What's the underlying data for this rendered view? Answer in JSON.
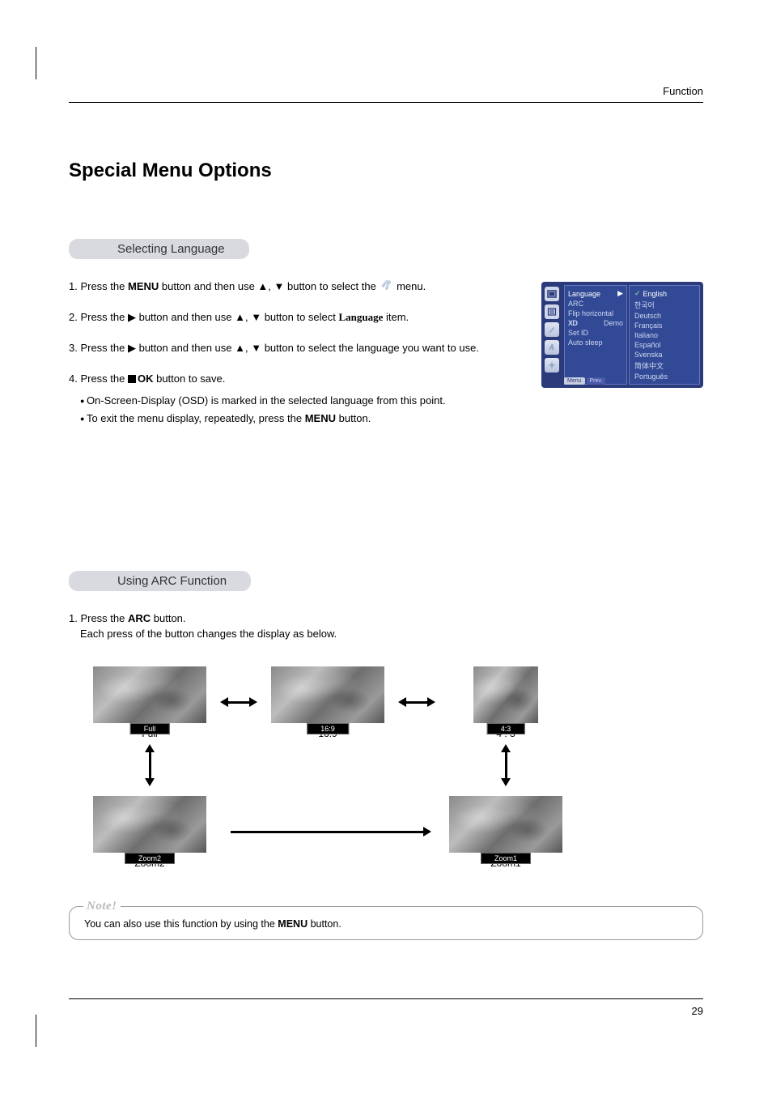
{
  "header": {
    "section": "Function"
  },
  "page_number": "29",
  "title": "Special Menu Options",
  "lang_section": {
    "heading": "Selecting Language",
    "steps": [
      {
        "pre": "1. Press the ",
        "bold": "MENU",
        "post": " button and then use ▲, ▼ button to select the ",
        "tail": " menu."
      },
      {
        "pre": "2. Press the ▶ button and then use ▲, ▼ button to select ",
        "bold": "Language",
        "post": " item."
      },
      {
        "pre": "3. Press the ▶ button and then use ▲, ▼ button to select the language you want to use."
      },
      {
        "pre": "4. Press the ",
        "ok": true,
        "post": " button to save."
      }
    ],
    "bullets": [
      "On-Screen-Display (OSD) is marked in the selected language from this point.",
      {
        "pre": "To exit the menu display, repeatedly, press the ",
        "bold": "MENU",
        "post": " button."
      }
    ]
  },
  "osd": {
    "menu_items": [
      "Language",
      "ARC",
      "Flip horizontal",
      "XD Demo",
      "Set ID",
      "Auto sleep"
    ],
    "selected_menu": "Language",
    "languages": [
      "English",
      "한국어",
      "Deutsch",
      "Français",
      "Italiano",
      "Español",
      "Svenska",
      "简体中文",
      "Português"
    ],
    "selected_language": "English",
    "footer": {
      "menu": "Menu",
      "prev": "Prev."
    }
  },
  "arc_section": {
    "heading": "Using ARC Function",
    "step_prefix": "1. Press the ",
    "step_bold": "ARC",
    "step_suffix": " button.",
    "step_line2": "Each press of the button changes the display as below.",
    "thumbs": {
      "full": {
        "tag": "Full",
        "caption": "Full"
      },
      "r169": {
        "tag": "16:9",
        "caption": "16:9"
      },
      "r43": {
        "tag": "4:3",
        "caption": "4 : 3"
      },
      "zoom2": {
        "tag": "Zoom2",
        "caption": "Zoom2"
      },
      "zoom1": {
        "tag": "Zoom1",
        "caption": "Zoom1"
      }
    }
  },
  "note": {
    "label": "Note!",
    "text_pre": "You can also use this function by using the ",
    "text_bold": "MENU",
    "text_post": " button."
  }
}
